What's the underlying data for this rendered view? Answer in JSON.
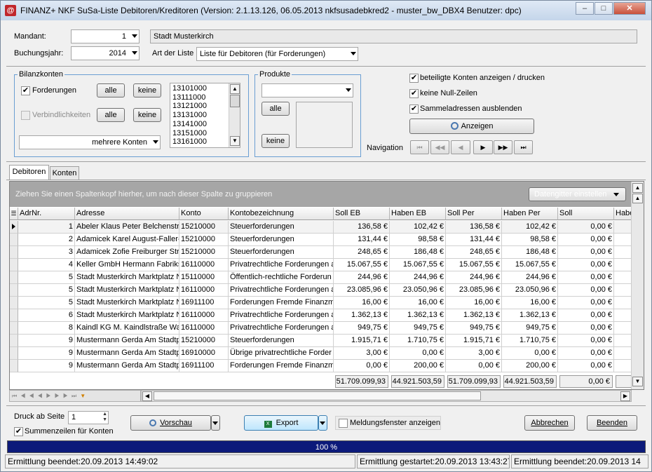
{
  "window": {
    "title": "FINANZ+ NKF SuSa-Liste Debitoren/Kreditoren (Version: 2.1.13.126, 06.05.2013 nkfsusadebkred2 - muster_bw_DBX4 Benutzer: dpc)",
    "app_icon": "finanz-app-icon",
    "min_label": "–",
    "max_label": "□",
    "close_label": "✕"
  },
  "header": {
    "mandant_label": "Mandant:",
    "mandant_value": "1",
    "mandant_name": "Stadt Musterkirch",
    "jahr_label": "Buchungsjahr:",
    "jahr_value": "2014",
    "art_label": "Art der Liste",
    "art_value": "Liste für Debitoren (für Forderungen)"
  },
  "bilanzkonten": {
    "title": "Bilanzkonten",
    "forderungen_label": "Forderungen",
    "forderungen_checked": true,
    "verbindlichkeiten_label": "Verbindlichkeiten",
    "verbindlichkeiten_checked": false,
    "alle_label": "alle",
    "keine_label": "keine",
    "mehrere_label": "mehrere Konten",
    "accounts": [
      "13101000",
      "13111000",
      "13121000",
      "13131000",
      "13141000",
      "13151000",
      "13161000"
    ]
  },
  "produkte": {
    "title": "Produkte",
    "select_value": "",
    "alle_label": "alle",
    "keine_label": "keine"
  },
  "options": {
    "beteiligte_label": "beteiligte Konten anzeigen / drucken",
    "beteiligte_checked": true,
    "nullzeilen_label": "keine Null-Zeilen",
    "nullzeilen_checked": true,
    "sammel_label": "Sammeladressen ausblenden",
    "sammel_checked": true,
    "anzeigen_label": "Anzeigen",
    "navigation_label": "Navigation",
    "nav_buttons": [
      "⏮",
      "◀◀",
      "◀",
      "▶",
      "▶▶",
      "⏭"
    ]
  },
  "tabs": [
    "Debitoren",
    "Konten"
  ],
  "grid": {
    "group_hint": "Ziehen Sie einen Spaltenkopf hierher, um nach dieser Spalte zu gruppieren",
    "einstellen_label": "Datengitter einstellen",
    "columns": [
      "AdrNr.",
      "Adresse",
      "Konto",
      "Kontobezeichnung",
      "Soll EB",
      "Haben EB",
      "Soll Per",
      "Haben Per",
      "Soll",
      "Habe"
    ],
    "rows": [
      [
        "1",
        "Abeler Klaus Peter Belchenstr.",
        "15210000",
        "Steuerforderungen",
        "136,58 €",
        "102,42 €",
        "136,58 €",
        "102,42 €",
        "0,00 €"
      ],
      [
        "2",
        "Adamicek Karel August-Faller-S",
        "15210000",
        "Steuerforderungen",
        "131,44 €",
        "98,58 €",
        "131,44 €",
        "98,58 €",
        "0,00 €"
      ],
      [
        "3",
        "Adamicek Zofie Freiburger Str.",
        "15210000",
        "Steuerforderungen",
        "248,65 €",
        "186,48 €",
        "248,65 €",
        "186,48 €",
        "0,00 €"
      ],
      [
        "4",
        "Keller GmbH Hermann Fabrikstr",
        "16110000",
        "Privatrechtliche Forderungen a",
        "15.067,55 €",
        "15.067,55 €",
        "15.067,55 €",
        "15.067,55 €",
        "0,00 €"
      ],
      [
        "5",
        "Stadt Musterkirch  Marktplatz N",
        "15110000",
        "Öffentlich-rechtliche Forderun",
        "244,96 €",
        "244,96 €",
        "244,96 €",
        "244,96 €",
        "0,00 €"
      ],
      [
        "5",
        "Stadt Musterkirch  Marktplatz N",
        "16110000",
        "Privatrechtliche Forderungen a",
        "23.085,96 €",
        "23.050,96 €",
        "23.085,96 €",
        "23.050,96 €",
        "0,00 €"
      ],
      [
        "5",
        "Stadt Musterkirch  Marktplatz N",
        "16911100",
        "Forderungen Fremde Finanzmi",
        "16,00 €",
        "16,00 €",
        "16,00 €",
        "16,00 €",
        "0,00 €"
      ],
      [
        "6",
        "Stadt Musterkirch  Marktplatz N",
        "16110000",
        "Privatrechtliche Forderungen a",
        "1.362,13 €",
        "1.362,13 €",
        "1.362,13 €",
        "1.362,13 €",
        "0,00 €"
      ],
      [
        "8",
        "Kaindl KG M. Kaindlstraße Wals",
        "16110000",
        "Privatrechtliche Forderungen a",
        "949,75 €",
        "949,75 €",
        "949,75 €",
        "949,75 €",
        "0,00 €"
      ],
      [
        "9",
        "Mustermann Gerda Am Stadtpa",
        "15210000",
        "Steuerforderungen",
        "1.915,71 €",
        "1.710,75 €",
        "1.915,71 €",
        "1.710,75 €",
        "0,00 €"
      ],
      [
        "9",
        "Mustermann Gerda Am Stadtpa",
        "16910000",
        "Übrige privatrechtliche Forder",
        "3,00 €",
        "0,00 €",
        "3,00 €",
        "0,00 €",
        "0,00 €"
      ],
      [
        "9",
        "Mustermann Gerda Am Stadtpa",
        "16911100",
        "Forderungen Fremde Finanzmi",
        "0,00 €",
        "200,00 €",
        "0,00 €",
        "200,00 €",
        "0,00 €"
      ]
    ],
    "sums": [
      "51.709.099,93",
      "44.921.503,59",
      "51.709.099,93",
      "44.921.503,59",
      "0,00 €"
    ]
  },
  "bottom": {
    "druck_label": "Druck ab Seite",
    "druck_value": "1",
    "summen_label": "Summenzeilen für Konten",
    "summen_checked": true,
    "vorschau_label": "Vorschau",
    "export_label": "Export",
    "meldung_label": "Meldungsfenster anzeigen",
    "meldung_checked": false,
    "abbrechen_label": "Abbrechen",
    "beenden_label": "Beenden"
  },
  "progress": {
    "percent": 100,
    "label": "100 %"
  },
  "statusbar": {
    "left": "Ermittlung beendet:20.09.2013 14:49:02",
    "mid": "Ermittlung gestartet:20.09.2013 13:43:27",
    "right": "Ermittlung beendet:20.09.2013 14"
  }
}
